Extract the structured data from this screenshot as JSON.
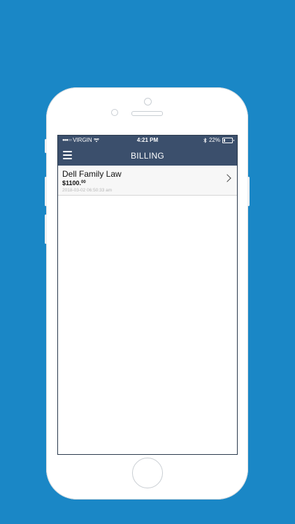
{
  "status_bar": {
    "carrier": "VIRGIN",
    "signal_dots": "●●●○○",
    "time": "4:21 PM",
    "battery_percent": "22%",
    "battery_level": 0.22
  },
  "nav": {
    "title": "BILLING",
    "menu_icon": "hamburger-icon"
  },
  "billing_items": [
    {
      "name": "Dell Family Law",
      "amount_main": "$1100.",
      "amount_cents": "00",
      "date": "2018-03-02 06:50:33 am"
    }
  ],
  "colors": {
    "background": "#1a87c6",
    "nav_bar": "#3b4f6c",
    "list_item_bg": "#f7f7f7"
  }
}
